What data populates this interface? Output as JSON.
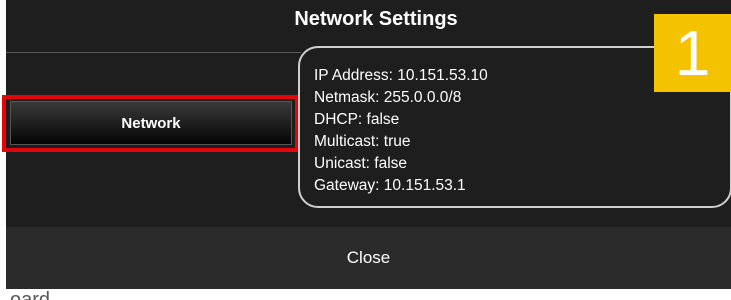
{
  "dialog": {
    "title": "Network Settings",
    "nav_items": [
      {
        "label": "Network",
        "selected": true
      }
    ],
    "info_lines": [
      "IP Address: 10.151.53.10",
      "Netmask: 255.0.0.0/8",
      "DHCP: false",
      "Multicast: true",
      "Unicast: false",
      "Gateway: 10.151.53.1"
    ],
    "close_label": "Close"
  },
  "annotation": {
    "step_number": "1",
    "badge_color": "#f5c200",
    "highlight_color": "#e4050b"
  },
  "background": {
    "partial_text": "oard"
  }
}
